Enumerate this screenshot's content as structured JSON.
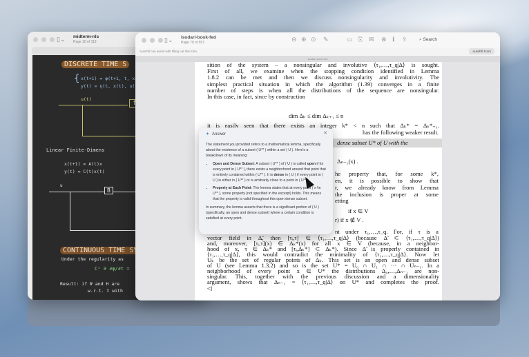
{
  "left_window": {
    "title": "midterm-nls",
    "subtitle": "Page 10 of 119",
    "notes": {
      "title1": "DISCRETE TIME S",
      "eq1": "x(t+1) = φ(t+1, t, x",
      "eq2": "y(t) = η(t, x(t), u(t))",
      "input1": "u(t)",
      "block_f": "f",
      "heading2": "Linear  Finite-Dimens",
      "eq3": "x(t+1) = A(t)x",
      "eq4": "y(t) = C(t)x(t)",
      "input2": "u",
      "block_b": "B",
      "title2": "CONTINUOUS TIME SY",
      "cont1": "Under the regularity  as",
      "cont2": "C¹ ∋ ∂ψ/∂t =",
      "result1": "Result: if Ψ and H are",
      "result2": "w.r.t. t with"
    }
  },
  "right_window": {
    "title": "isodari-book-fed",
    "subtitle": "Page 70 of 557",
    "search_placeholder": "Search",
    "autofill_text": "AutoFill can assist with filling out this form.",
    "autofill_button": "AutoFill Form",
    "tab_label": "isodari-book-fed",
    "page_lines": {
      "l1": "sition of the system – a nonsingular and involutive ⟨τ₁,…,τ_q|Δ⟩ is sought.",
      "l2": "First of all, we examine when the stopping condition identified in Lemma",
      "l3": "1.8.2 can be met and then we discuss nonsingularity and involutivity. The",
      "l4": "simplest practical situation in which the algorithm (1.39) converges in a finite",
      "l5": "number of steps is when all the distributions of the sequence are nonsingular.",
      "l6": "In this case, in fact, since by construction",
      "eq1": "dim Δₖ ≤ dim Δₖ₊₁ ≤ n",
      "l7": "it is easily seen that there exists an integer k* < n such that Δₖ* = Δₖ*₊₁.",
      "f1": "has the following weaker result.",
      "f2": "dense subset U* of U with the",
      "f3": "Δₙ₋₁(x) .",
      "f4": "he property that, for some k*,",
      "f5": "en, it is possible to show that",
      "f6": "r, we already know from Lemma",
      "f7": "the inclusion is proper at some",
      "f8": "etting",
      "f9": "if x ∈ V",
      "f10": "r)       if x ∉ V .",
      "f11": "nt under τ₁,…,τ_q. For, if τ is a",
      "m1": "vector field in Δ̃, then [τᵢ,τ] ∈ ⟨τ₁,…,τ_q|Δ⟩ (because Δ̃ ⊂ ⟨τ₁,…,τ_q|Δ⟩)",
      "m2": "and, moreover, [τᵢ,τ](x) ∈ Δₖ*(x) for all x ∈ V (because, in a neighbor-",
      "m3": "hood of x, τ ∈ Δₖ* and [τᵢ,Δₖ*] ⊂ Δₖ*). Since Δ̃ is properly contained in",
      "m4": "⟨τ₁,…,τ_q|Δ⟩, this would contradict the minimality of ⟨τ₁,…,τ_q|Δ⟩. Now let",
      "m5": "Uₖ be the set of regular points of Δₖ. This set is an open and dense subset",
      "m6": "of U (see Lemma 1.3.2) and so is the set U* = U₀ ∩ U₁ ∩ ··· ∩ Uₙ₋₁. In a",
      "m7": "neighborhood of every point x ∈ U* the distributions Δ₀,…,Δₙ₋₁ are non-",
      "m8": "singular. This, together with the previous discussion and a dimensionality",
      "m9": "argument, shows that Δₙ₋₁ = ⟨τ₁,…,τ_q|Δ⟩ on U* and completes the proof.",
      "qed": "◁"
    }
  },
  "answer_popup": {
    "title": "Answer",
    "intro": "The statement you provided refers to a mathematical lemma, specifically about the existence of a subset ( U** ) within a set ( U ). Here's a breakdown of its meaning:",
    "b1_title": "Open and Dense Subset",
    "b1_a": ": A subset ( U** ) of ( U ) is called ",
    "b1_open": "open",
    "b1_b": " if for every point in ( U** ), there exists a neighborhood around that point that is entirely contained within ( U** ). It is ",
    "b1_dense": "dense",
    "b1_c": " in ( U ) if every point in ( U ) is either in ( U** ) or is arbitrarily close to a point in ( U** ).",
    "b2_title": "Property at Each Point",
    "b2_text": ": The lemma states that at every point ( x \\in U** ), some property (not specified in the excerpt) holds. This means that the property is valid throughout this open dense subset.",
    "summary": "In summary, the lemma asserts that there is a significant portion of ( U ) (specifically, an open and dense subset) where a certain condition is satisfied at every point."
  }
}
